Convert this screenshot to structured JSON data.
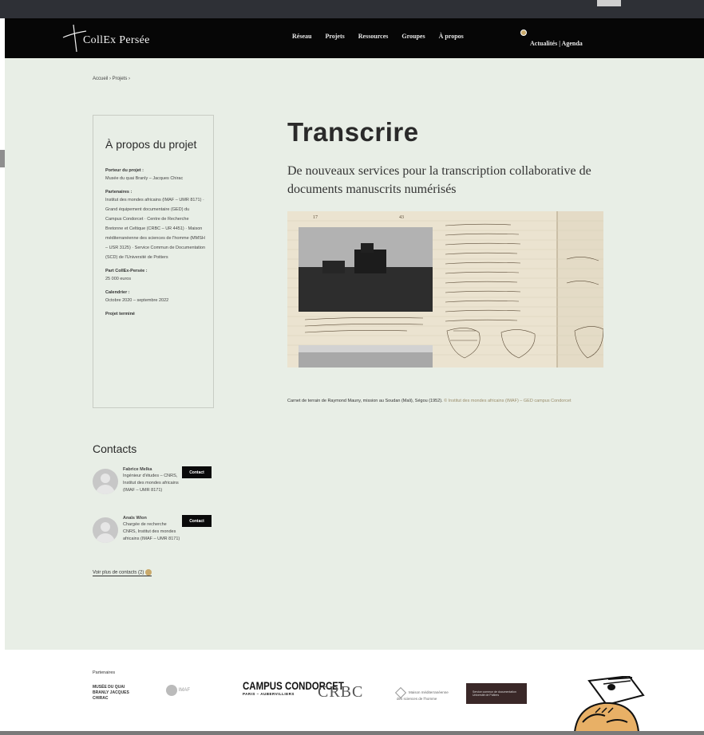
{
  "header": {
    "logo_text": "CollEx Persée",
    "nav": [
      {
        "label": "Réseau"
      },
      {
        "label": "Projets"
      },
      {
        "label": "Ressources"
      },
      {
        "label": "Groupes"
      },
      {
        "label": "À propos"
      }
    ],
    "extra": "Actualités | Agenda"
  },
  "breadcrumb": "Accueil › Projets ›",
  "sidebar": {
    "title": "À propos du projet",
    "sections": [
      {
        "label": "Porteur du projet :",
        "text": "Musée du quai Branly – Jacques Chirac"
      },
      {
        "label": "Partenaires :",
        "text": "Institut des mondes africains (IMAF – UMR 8171) · Grand équipement documentaire (GED) du Campus Condorcet · Centre de Recherche Bretonne et Celtique (CRBC – UR 4451) · Maison méditerranéenne des sciences de l'homme (MMSH – USR 3125) · Service Commun de Documentation (SCD) de l'Université de Poitiers"
      },
      {
        "label": "Part CollEx-Persée :",
        "text": "25 000 euros"
      },
      {
        "label": "Calendrier :",
        "text": "Octobre 2020 – septembre 2022"
      },
      {
        "label": "Projet terminé",
        "text": ""
      }
    ]
  },
  "contacts": {
    "title": "Contacts",
    "items": [
      {
        "name": "Fabrice Melka",
        "role": "Ingénieur d'études – CNRS, Institut des mondes africains (IMAF – UMR 8171)",
        "button": "Contact"
      },
      {
        "name": "Anaïs Wion",
        "role": "Chargée de recherche CNRS, Institut des mondes africains (IMAF – UMR 8171)",
        "button": "Contact"
      }
    ],
    "more": "Voir plus de contacts (2)"
  },
  "main": {
    "title": "Transcrire",
    "subtitle": "De nouveaux services pour la transcription collaborative de documents manuscrits numérisés",
    "caption": "Carnet de terrain de Raymond Mauny, mission au Soudan (Mali), Ségou (1952).",
    "caption_credit": "© Institut des mondes africains (IMAF) – GED campus Condorcet"
  },
  "partners": {
    "label": "Partenaires",
    "items": [
      {
        "name": "MUSÉE DU QUAI BRANLY JACQUES CHIRAC"
      },
      {
        "name": "IMAF"
      },
      {
        "name": "CAMPUS CONDORCET",
        "sub": "PARIS – AUBERVILLIERS"
      },
      {
        "name": "CRBC"
      },
      {
        "name": "Maison méditerranéenne des sciences de l'homme"
      },
      {
        "name": "Service commun de documentation Université de Poitiers"
      }
    ]
  }
}
